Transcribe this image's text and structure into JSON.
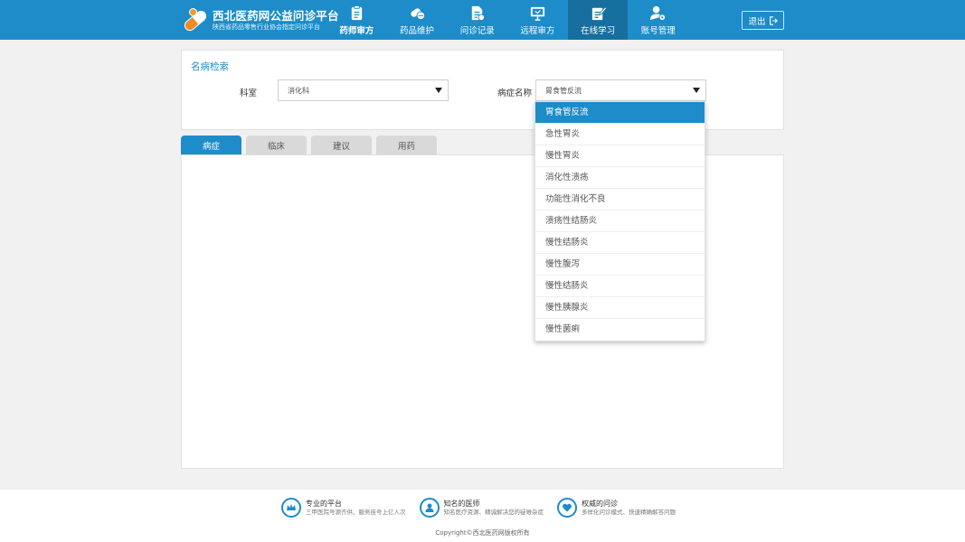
{
  "brand": {
    "title": "西北医药网公益问诊平台",
    "subtitle": "陕西省药品零售行业协会指定问诊平台"
  },
  "nav": [
    {
      "label": "药师审方",
      "icon": "clipboard-icon"
    },
    {
      "label": "药品维护",
      "icon": "pills-icon"
    },
    {
      "label": "问诊记录",
      "icon": "document-icon"
    },
    {
      "label": "远程审方",
      "icon": "monitor-icon"
    },
    {
      "label": "在线学习",
      "icon": "edit-book-icon",
      "active": true
    },
    {
      "label": "账号管理",
      "icon": "user-settings-icon"
    }
  ],
  "logout": "退出",
  "search": {
    "title": "名病检索",
    "department_label": "科室",
    "department_value": "消化科",
    "disease_label": "病症名称",
    "disease_value": "胃食管反流"
  },
  "tabs": [
    "病症",
    "临床",
    "建议",
    "用药"
  ],
  "dropdown": {
    "options": [
      "胃食管反流",
      "急性胃炎",
      "慢性胃炎",
      "消化性溃疡",
      "功能性消化不良",
      "溃疡性结肠炎",
      "慢性结肠炎",
      "慢性腹泻",
      "慢性结肠炎",
      "慢性胰腺炎",
      "慢性菌痢"
    ],
    "selected_index": 0
  },
  "footer": {
    "features": [
      {
        "title": "专业的平台",
        "desc": "三甲医院号源齐供、服务挂号上亿人次",
        "icon": "crown-icon"
      },
      {
        "title": "知名的医师",
        "desc": "知名医疗资源、精诚解决您的疑难杂症",
        "icon": "doctor-icon"
      },
      {
        "title": "权威的问诊",
        "desc": "多样化问诊模式、快速精确解答问题",
        "icon": "heart-icon"
      }
    ],
    "copyright": "Copyright©西北医药网版权所有"
  },
  "colors": {
    "primary": "#1d8cc9",
    "nav_active": "#166f9f",
    "accent": "#f08a24"
  }
}
